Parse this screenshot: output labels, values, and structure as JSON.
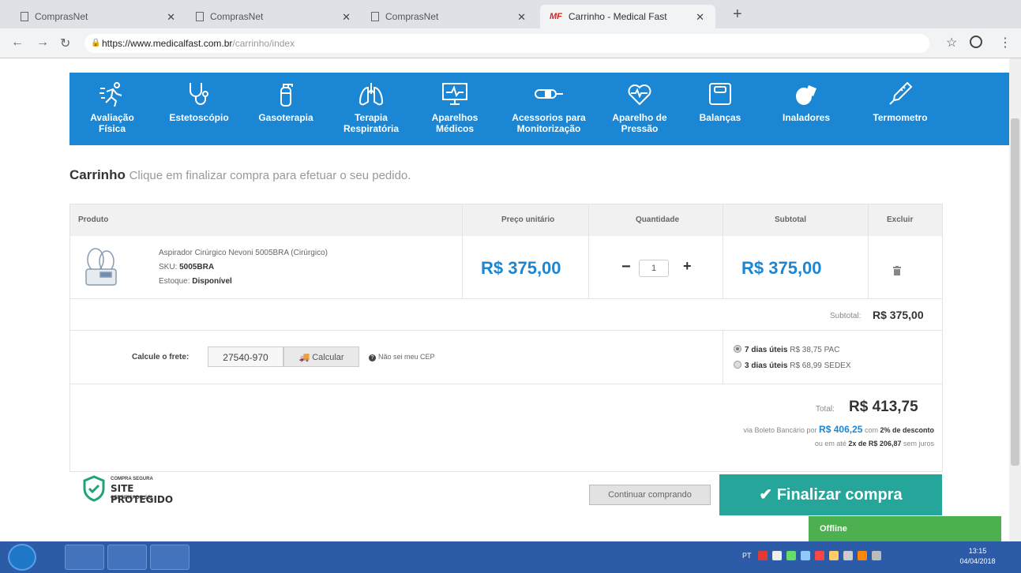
{
  "browser": {
    "tabs": [
      {
        "title": "ComprasNet"
      },
      {
        "title": "ComprasNet"
      },
      {
        "title": "ComprasNet"
      },
      {
        "title": "Carrinho - Medical Fast",
        "active": true
      }
    ],
    "url_host": "https://www.medicalfast.com.br",
    "url_path": "/carrinho/index",
    "new_tab_symbol": "+"
  },
  "categories": [
    {
      "label": "Avaliação Física",
      "icon": "runner-icon"
    },
    {
      "label": "Estetoscópio",
      "icon": "stethoscope-icon"
    },
    {
      "label": "Gasoterapia",
      "icon": "oxygen-cylinder-icon"
    },
    {
      "label": "Terapia Respiratória",
      "icon": "lungs-icon"
    },
    {
      "label": "Aparelhos Médicos",
      "icon": "monitor-icon"
    },
    {
      "label": "Acessorios para Monitorização",
      "icon": "sensor-icon"
    },
    {
      "label": "Aparelho de Pressão",
      "icon": "heart-pressure-icon"
    },
    {
      "label": "Balanças",
      "icon": "scale-icon"
    },
    {
      "label": "Inaladores",
      "icon": "inhaler-icon"
    },
    {
      "label": "Termometro",
      "icon": "thermometer-icon"
    }
  ],
  "cart": {
    "title": "Carrinho",
    "subtitle": "Clique em finalizar compra para efetuar o seu pedido.",
    "headers": {
      "product": "Produto",
      "unit_price": "Preço unitário",
      "quantity": "Quantidade",
      "subtotal": "Subtotal",
      "delete": "Excluir"
    },
    "item": {
      "name": "Aspirador Cirúrgico Nevoni 5005BRA (Cirúrgico)",
      "sku_label": "SKU:",
      "sku": "5005BRA",
      "stock_label": "Estoque:",
      "stock": "Disponível",
      "unit_price": "R$ 375,00",
      "quantity": "1",
      "subtotal": "R$ 375,00"
    },
    "qty_minus": "−",
    "qty_plus": "+",
    "subtotal_label": "Subtotal:",
    "subtotal_value": "R$ 375,00",
    "shipping": {
      "label": "Calcule o frete:",
      "cep": "27540-970",
      "button": "Calcular",
      "help": "Não sei meu CEP",
      "options": [
        {
          "days": "7 dias úteis",
          "price": "R$ 38,75",
          "carrier": "PAC",
          "selected": true
        },
        {
          "days": "3 dias úteis",
          "price": "R$ 68,99",
          "carrier": "SEDEX",
          "selected": false
        }
      ]
    },
    "total_label": "Total:",
    "total_value": "R$ 413,75",
    "boleto_prefix": "via Boleto Bancário por",
    "boleto_value": "R$ 406,25",
    "boleto_mid": "com",
    "boleto_discount": "2% de desconto",
    "installment_prefix": "ou em até",
    "installment_value": "2x de R$ 206,87",
    "installment_suffix": "sem juros"
  },
  "seal": {
    "top": "COMPRA SEGURA",
    "main": "SITE PROTEGIDO",
    "bottom": "CERTIFICADO SSL"
  },
  "actions": {
    "continue": "Continuar comprando",
    "finalize": "Finalizar compra"
  },
  "chat": {
    "status": "Offline"
  },
  "taskbar": {
    "lang": "PT",
    "time": "13:15",
    "date": "04/04/2018"
  },
  "colors": {
    "brand_blue": "#1b86d3",
    "finalize_green": "#26a69a",
    "offline_green": "#4caf50"
  }
}
